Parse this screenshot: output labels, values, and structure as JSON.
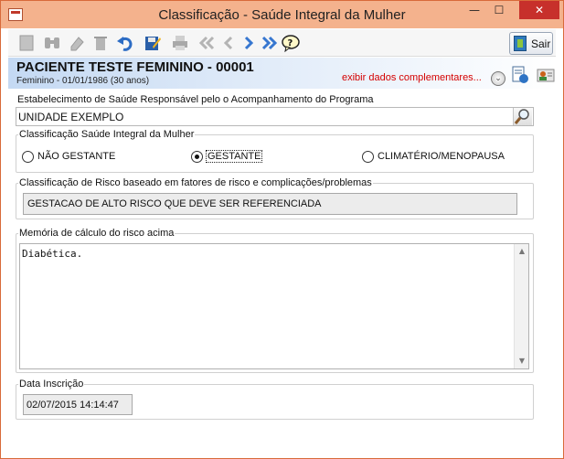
{
  "window": {
    "title": "Classificação - Saúde Integral da Mulher",
    "minimize_glyph": "—",
    "maximize_glyph": "☐",
    "close_glyph": "✕"
  },
  "toolbar": {
    "icons": [
      "new-icon",
      "binoculars-icon",
      "eraser-icon",
      "trash-icon",
      "undo-icon",
      "edit-save-icon",
      "print-icon",
      "first-icon",
      "previous-icon",
      "next-icon",
      "last-icon",
      "help-icon"
    ],
    "exit_label": "Sair"
  },
  "patient": {
    "name": "PACIENTE TESTE FEMININO - 00001",
    "details": "Feminino - 01/01/1986 (30 anos)",
    "complementary_link": "exibir dados complementares...",
    "toggle_glyph": "⌄"
  },
  "establishment": {
    "label": "Estabelecimento de Saúde Responsável pelo o Acompanhamento do Programa",
    "value": "UNIDADE EXEMPLO"
  },
  "classification": {
    "legend": "Classificação Saúde Integral da Mulher",
    "options": [
      {
        "label": "NÃO GESTANTE",
        "selected": false
      },
      {
        "label": "GESTANTE",
        "selected": true
      },
      {
        "label": "CLIMATÉRIO/MENOPAUSA",
        "selected": false
      }
    ]
  },
  "risk": {
    "legend": "Classificação de Risco baseado em fatores de risco e complicações/problemas",
    "value": "GESTACAO DE ALTO RISCO QUE DEVE SER REFERENCIADA"
  },
  "memory": {
    "legend": "Memória de cálculo do risco acima",
    "value": "Diabética.",
    "scroll_up_glyph": "▲",
    "scroll_down_glyph": "▼"
  },
  "registration": {
    "legend": "Data Inscrição",
    "value": "02/07/2015 14:14:47"
  },
  "colors": {
    "titlebar": "#f4b28d",
    "close_button": "#c7302b",
    "link": "#d40000",
    "band_start": "#c4d9f3"
  }
}
